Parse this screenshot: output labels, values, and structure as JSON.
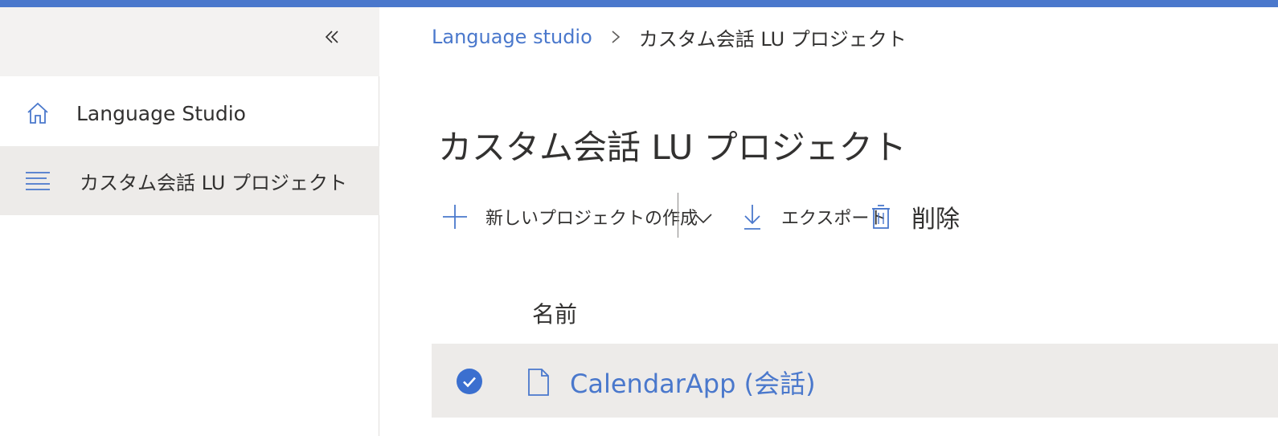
{
  "sidebar": {
    "items": [
      {
        "label": "Language Studio",
        "icon": "home-icon"
      },
      {
        "label": "カスタム会話 LU プロジェクト",
        "icon": "list-icon",
        "active": true
      }
    ]
  },
  "breadcrumb": {
    "items": [
      "Language studio",
      "カスタム会話 LU プロジェクト"
    ]
  },
  "main": {
    "title": "カスタム会話 LU プロジェクト",
    "commands": {
      "new_label": "新しいプロジェクトの作成",
      "export_label": "エクスポート",
      "delete_label": "削除"
    },
    "table": {
      "columns": [
        "名前"
      ],
      "rows": [
        {
          "name": "CalendarApp (会話)",
          "selected": true
        }
      ]
    }
  },
  "colors": {
    "accent": "#4a78cc",
    "sidebar_bg": "#f3f2f1",
    "selected_bg": "#edebe9"
  }
}
